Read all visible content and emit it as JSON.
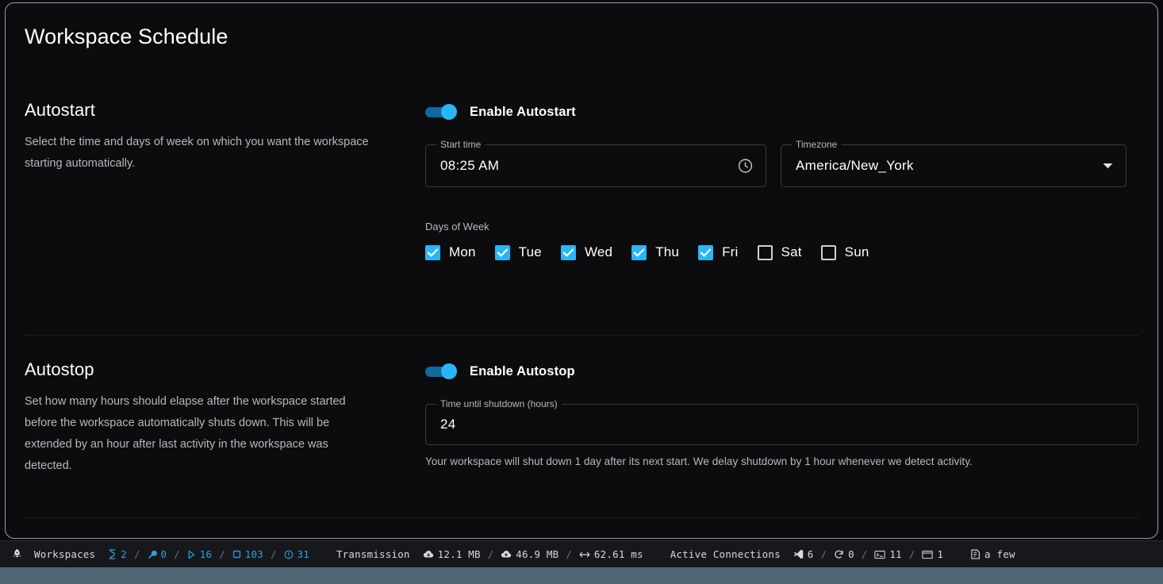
{
  "page": {
    "title": "Workspace Schedule"
  },
  "autostart": {
    "heading": "Autostart",
    "description": "Select the time and days of week on which you want the workspace starting automatically.",
    "toggle_label": "Enable Autostart",
    "toggle_on": true,
    "start_time": {
      "legend": "Start time",
      "value": "08:25 AM",
      "icon": "clock-icon"
    },
    "timezone": {
      "legend": "Timezone",
      "value": "America/New_York",
      "icon": "chevron-down-icon"
    },
    "days": {
      "label": "Days of Week",
      "items": [
        {
          "label": "Mon",
          "checked": true
        },
        {
          "label": "Tue",
          "checked": true
        },
        {
          "label": "Wed",
          "checked": true
        },
        {
          "label": "Thu",
          "checked": true
        },
        {
          "label": "Fri",
          "checked": true
        },
        {
          "label": "Sat",
          "checked": false
        },
        {
          "label": "Sun",
          "checked": false
        }
      ]
    }
  },
  "autostop": {
    "heading": "Autostop",
    "description": "Set how many hours should elapse after the workspace started before the workspace automatically shuts down. This will be extended by an hour after last activity in the workspace was detected.",
    "toggle_label": "Enable Autostop",
    "toggle_on": true,
    "shutdown": {
      "legend": "Time until shutdown (hours)",
      "value": "24"
    },
    "helper_text": "Your workspace will shut down 1 day after its next start. We delay shutdown by 1 hour whenever we detect activity."
  },
  "statusbar": {
    "lead_icon": "rocket-icon",
    "workspaces": {
      "title": "Workspaces",
      "stats": [
        {
          "icon": "person-icon",
          "value": "2"
        },
        {
          "icon": "wrench-icon",
          "value": "0"
        },
        {
          "icon": "play-icon",
          "value": "16"
        },
        {
          "icon": "stop-icon",
          "value": "103"
        },
        {
          "icon": "alert-circle-icon",
          "value": "31"
        }
      ]
    },
    "transmission": {
      "title": "Transmission",
      "stats": [
        {
          "icon": "cloud-down-icon",
          "value": "12.1 MB"
        },
        {
          "icon": "cloud-up-icon",
          "value": "46.9 MB"
        },
        {
          "icon": "latency-icon",
          "value": "62.61 ms"
        }
      ]
    },
    "connections": {
      "title": "Active Connections",
      "stats": [
        {
          "icon": "vscode-icon",
          "value": "6"
        },
        {
          "icon": "jetbrains-icon",
          "value": "0"
        },
        {
          "icon": "terminal-icon",
          "value": "11"
        },
        {
          "icon": "window-icon",
          "value": "1"
        }
      ]
    },
    "refreshed": {
      "icon": "refresh-icon",
      "value": "a few"
    },
    "separator": "/"
  },
  "colors": {
    "accent_blue": "#29b6f6",
    "track_blue": "#10699f",
    "status_blue": "#2f9fe0",
    "panel_border": "#a195b4",
    "bottom_bar": "#4e6672"
  }
}
